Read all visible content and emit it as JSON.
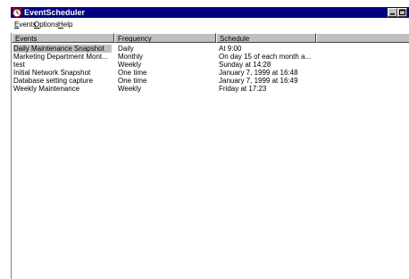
{
  "window": {
    "title": "EventScheduler",
    "icon": "alarm-clock-icon",
    "title_bar_color": "#000080"
  },
  "menu": {
    "items": [
      {
        "label_u": "E",
        "label_rest": "vents"
      },
      {
        "label_u": "O",
        "label_rest": "ptions"
      },
      {
        "label_u": "H",
        "label_rest": "elp"
      }
    ]
  },
  "list": {
    "columns": [
      "Events",
      "Frequency",
      "Schedule",
      ""
    ],
    "rows": [
      {
        "event": "Daily Maintenance Snapshot",
        "frequency": "Daily",
        "schedule": "At 9:00",
        "selected": true
      },
      {
        "event": "Marketing Department Mont...",
        "frequency": "Monthly",
        "schedule": "On day 15 of each month a...",
        "selected": false
      },
      {
        "event": "test",
        "frequency": "Weekly",
        "schedule": "Sunday at 14:28",
        "selected": false
      },
      {
        "event": "Initial Network Snapshot",
        "frequency": "One time",
        "schedule": "January 7, 1999 at 16:48",
        "selected": false
      },
      {
        "event": "Database setting capture",
        "frequency": "One time",
        "schedule": "January 7, 1999 at 16:49",
        "selected": false
      },
      {
        "event": "Weekly Maintenance",
        "frequency": "Weekly",
        "schedule": "Friday at 17:23",
        "selected": false
      }
    ]
  }
}
